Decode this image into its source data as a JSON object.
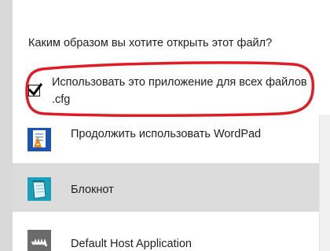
{
  "dialog": {
    "question": "Каким образом вы хотите открыть этот файл?",
    "always_use": {
      "label": "Использовать это приложение для всех файлов .cfg",
      "checked": true
    },
    "apps": [
      {
        "label": "Продолжить использовать WordPad",
        "icon": "wordpad-icon",
        "selected": false
      },
      {
        "label": "Блокнот",
        "icon": "notepad-icon",
        "selected": true
      },
      {
        "label": "Default Host Application",
        "icon": "host-app-icon",
        "selected": false
      }
    ]
  },
  "colors": {
    "highlight_ring": "#e01c24",
    "selected_row": "#dcdcdc",
    "text": "#1f1f1f"
  }
}
